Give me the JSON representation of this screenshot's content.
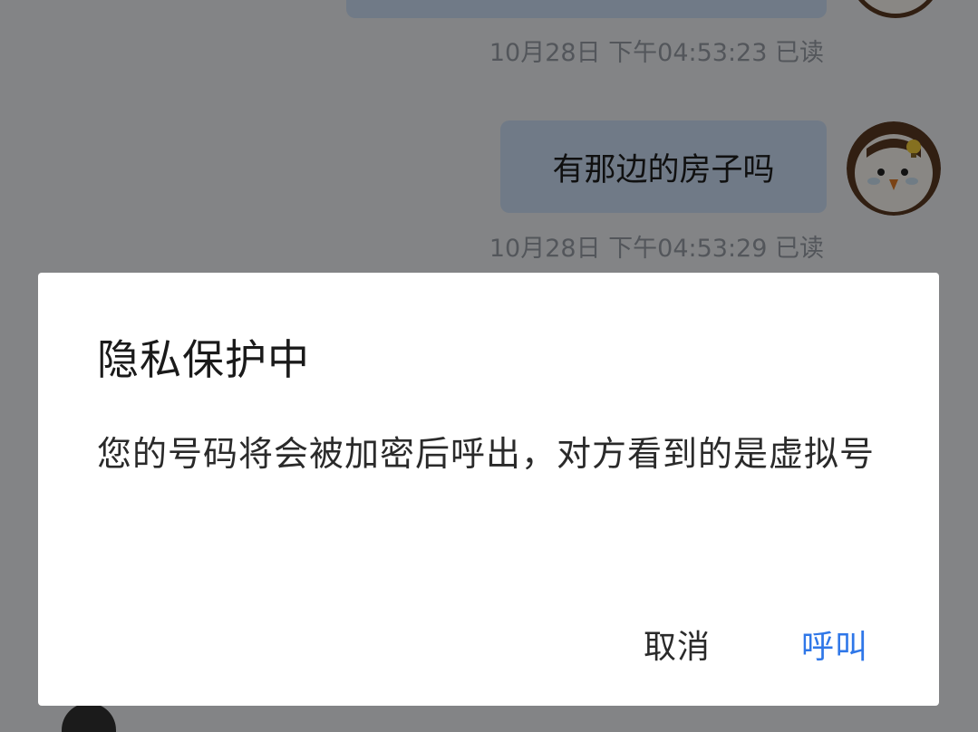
{
  "chat": {
    "messages": [
      {
        "text": "",
        "timestamp": "10月28日 下午04:53:23 已读"
      },
      {
        "text": "有那边的房子吗",
        "timestamp": "10月28日 下午04:53:29 已读"
      }
    ]
  },
  "dialog": {
    "title": "隐私保护中",
    "body": "您的号码将会被加密后呼出，对方看到的是虚拟号",
    "cancel_label": "取消",
    "call_label": "呼叫"
  },
  "colors": {
    "bubble": "#cfe2f9",
    "accent": "#2f77e8",
    "scrim": "rgba(0,0,0,0.46)"
  }
}
